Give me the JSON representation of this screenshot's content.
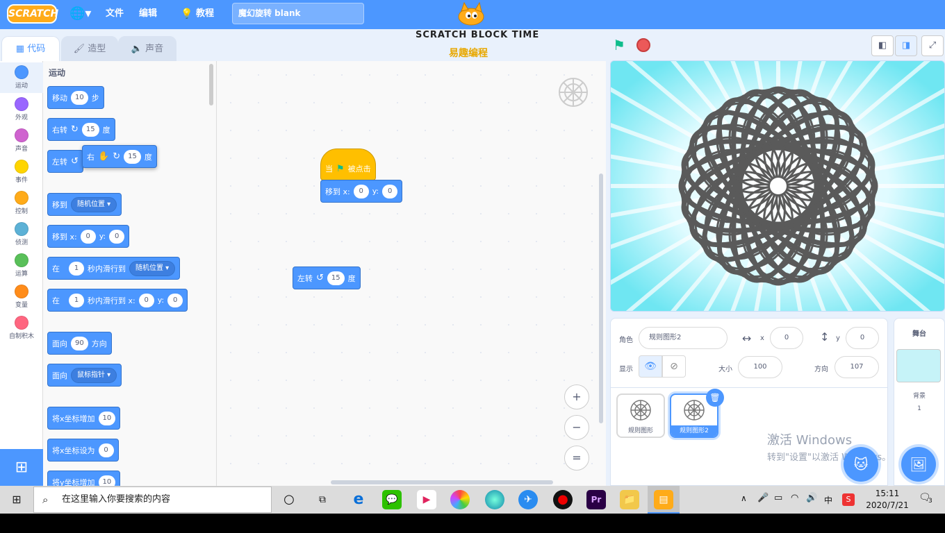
{
  "menubar": {
    "logo": "SCRATCH",
    "globe_icon": "globe-icon",
    "file": "文件",
    "edit": "编辑",
    "tutorial": "教程",
    "project_title": "魔幻旋转 blank"
  },
  "brand": {
    "title": "SCRATCH BLOCK TIME",
    "subtitle": "易趣编程"
  },
  "tabs": [
    "代码",
    "造型",
    "声音"
  ],
  "categories": [
    {
      "label": "运动",
      "color": "#4c97ff"
    },
    {
      "label": "外观",
      "color": "#9966ff"
    },
    {
      "label": "声音",
      "color": "#cf63cf"
    },
    {
      "label": "事件",
      "color": "#ffd500"
    },
    {
      "label": "控制",
      "color": "#ffab19"
    },
    {
      "label": "侦测",
      "color": "#5cb1d6"
    },
    {
      "label": "运算",
      "color": "#59c059"
    },
    {
      "label": "变量",
      "color": "#ff8c1a"
    },
    {
      "label": "自制积木",
      "color": "#ff6680"
    }
  ],
  "palette": {
    "section_title": "运动",
    "move": {
      "label": "移动",
      "value": "10",
      "unit": "步"
    },
    "turn_right": {
      "label": "右转",
      "value": "15",
      "unit": "度"
    },
    "turn_left": {
      "label": "左转",
      "value": "15",
      "unit": "度"
    },
    "goto": {
      "label": "移到",
      "dropdown": "随机位置"
    },
    "goto_xy": {
      "label": "移到 x:",
      "x": "0",
      "ylabel": "y:",
      "y": "0"
    },
    "glide": {
      "label": "在",
      "secs": "1",
      "mid": "秒内滑行到",
      "dropdown": "随机位置"
    },
    "glide_xy": {
      "label": "在",
      "secs": "1",
      "mid": "秒内滑行到 x:",
      "x": "0",
      "ylabel": "y:",
      "y": "0"
    },
    "point_dir": {
      "label": "面向",
      "value": "90",
      "unit": "方向"
    },
    "point_towards": {
      "label": "面向",
      "dropdown": "鼠标指针"
    },
    "change_x": {
      "label": "将x坐标增加",
      "value": "10"
    },
    "set_x": {
      "label": "将x坐标设为",
      "value": "0"
    },
    "change_y": {
      "label": "将y坐标增加",
      "value": "10"
    }
  },
  "dragging": {
    "label": "右",
    "value": "15",
    "unit": "度"
  },
  "workspace": {
    "hat": {
      "when": "当",
      "clicked": "被点击"
    },
    "goto_xy": {
      "label": "移到 x:",
      "x": "0",
      "ylabel": "y:",
      "y": "0"
    },
    "turn_left": {
      "label": "左转",
      "value": "15",
      "unit": "度"
    },
    "zoom_in": "+",
    "zoom_out": "−",
    "zoom_reset": "="
  },
  "sprite_info": {
    "sprite_label": "角色",
    "sprite_name": "规则图形2",
    "x_label": "x",
    "x": "0",
    "y_label": "y",
    "y": "0",
    "show_label": "显示",
    "size_label": "大小",
    "size": "100",
    "direction_label": "方向",
    "direction": "107"
  },
  "sprites": [
    {
      "name": "规则图形",
      "selected": false
    },
    {
      "name": "规则图形2",
      "selected": true
    }
  ],
  "stage_target": {
    "title": "舞台",
    "backdrops_label": "背景",
    "backdrops_count": "1"
  },
  "watermark": {
    "line1": "激活 Windows",
    "line2": "转到\"设置\"以激活 Windows。"
  },
  "taskbar": {
    "search_placeholder": "在这里输入你要搜索的内容",
    "ime": "中",
    "time": "15:11",
    "date": "2020/7/21",
    "notifications": "3"
  },
  "colors": {
    "accent": "#4c97ff",
    "event_yellow": "#ffbf00",
    "stage_bg": "#6fe6f2",
    "pattern": "#5a5a5a"
  }
}
